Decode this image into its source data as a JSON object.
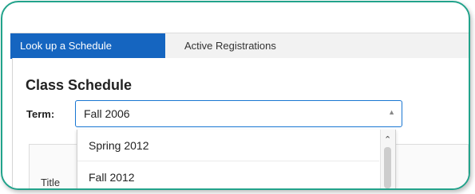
{
  "tabs": [
    {
      "label": "Look up a Schedule",
      "active": true
    },
    {
      "label": "Active Registrations",
      "active": false
    }
  ],
  "page": {
    "title": "Class Schedule"
  },
  "term": {
    "label": "Term:",
    "selected": "Fall 2006",
    "options": [
      "Spring 2012",
      "Fall 2012"
    ]
  },
  "table": {
    "headers": [
      "Title"
    ]
  },
  "colors": {
    "accent": "#1565c0",
    "highlight_frame": "#22a38b"
  }
}
